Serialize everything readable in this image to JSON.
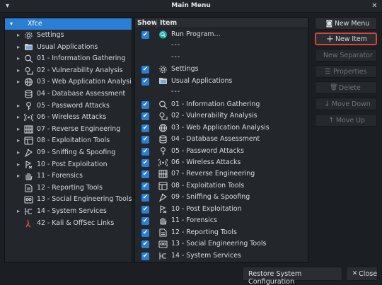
{
  "window": {
    "title": "Main Menu",
    "close_glyph": "✕",
    "menu_glyph": "▾"
  },
  "tree": {
    "root": {
      "label": "Xfce",
      "expander": "▾"
    },
    "items": [
      {
        "label": "Settings",
        "icon": "gear-icon",
        "expander": "▸"
      },
      {
        "label": "Usual Applications",
        "icon": "folder-icon",
        "expander": "▸"
      },
      {
        "label": "01 - Information Gathering",
        "icon": "magnifier-icon",
        "expander": "▸"
      },
      {
        "label": "02 - Vulnerability Analysis",
        "icon": "vulnerability-icon",
        "expander": "▸"
      },
      {
        "label": "03 - Web Application Analysis",
        "icon": "globe-icon",
        "expander": "▸"
      },
      {
        "label": "04 - Database Assessment",
        "icon": "database-icon",
        "expander": ""
      },
      {
        "label": "05 - Password Attacks",
        "icon": "key-icon",
        "expander": "▸"
      },
      {
        "label": "06 - Wireless Attacks",
        "icon": "wireless-icon",
        "expander": "▸"
      },
      {
        "label": "07 - Reverse Engineering",
        "icon": "chip-icon",
        "expander": "▸"
      },
      {
        "label": "08 - Exploitation Tools",
        "icon": "exploit-icon",
        "expander": "▸"
      },
      {
        "label": "09 - Sniffing & Spoofing",
        "icon": "sniff-icon",
        "expander": "▸"
      },
      {
        "label": "10 - Post Exploitation",
        "icon": "post-exploit-icon",
        "expander": "▸"
      },
      {
        "label": "11 - Forensics",
        "icon": "hand-icon",
        "expander": "▸"
      },
      {
        "label": "12 - Reporting Tools",
        "icon": "report-icon",
        "expander": ""
      },
      {
        "label": "13 - Social Engineering Tools",
        "icon": "social-icon",
        "expander": ""
      },
      {
        "label": "14 - System Services",
        "icon": "services-icon",
        "expander": "▸"
      },
      {
        "label": "42 - Kali & OffSec Links",
        "icon": "kali-dragon-icon",
        "expander": ""
      }
    ]
  },
  "list": {
    "headers": {
      "show": "Show",
      "item": "Item"
    },
    "check_glyph": "✔",
    "rows": [
      {
        "type": "item",
        "label": "Run Program...",
        "icon": "run-program-icon",
        "checked": true
      },
      {
        "type": "separator",
        "label": "---"
      },
      {
        "type": "separator",
        "label": "---"
      },
      {
        "type": "item",
        "label": "Settings",
        "icon": "gear-icon",
        "checked": true
      },
      {
        "type": "item",
        "label": "Usual Applications",
        "icon": "folder-icon",
        "checked": true
      },
      {
        "type": "separator",
        "label": "---"
      },
      {
        "type": "item",
        "label": "01 - Information Gathering",
        "icon": "magnifier-icon",
        "checked": true
      },
      {
        "type": "item",
        "label": "02 - Vulnerability Analysis",
        "icon": "vulnerability-icon",
        "checked": true
      },
      {
        "type": "item",
        "label": "03 - Web Application Analysis",
        "icon": "globe-icon",
        "checked": true
      },
      {
        "type": "item",
        "label": "04 - Database Assessment",
        "icon": "database-icon",
        "checked": true
      },
      {
        "type": "item",
        "label": "05 - Password Attacks",
        "icon": "key-icon",
        "checked": true
      },
      {
        "type": "item",
        "label": "06 - Wireless Attacks",
        "icon": "wireless-icon",
        "checked": true
      },
      {
        "type": "item",
        "label": "07 - Reverse Engineering",
        "icon": "chip-icon",
        "checked": true
      },
      {
        "type": "item",
        "label": "08 - Exploitation Tools",
        "icon": "exploit-icon",
        "checked": true
      },
      {
        "type": "item",
        "label": "09 - Sniffing & Spoofing",
        "icon": "sniff-icon",
        "checked": true
      },
      {
        "type": "item",
        "label": "10 - Post Exploitation",
        "icon": "post-exploit-icon",
        "checked": true
      },
      {
        "type": "item",
        "label": "11 - Forensics",
        "icon": "hand-icon",
        "checked": true
      },
      {
        "type": "item",
        "label": "12 - Reporting Tools",
        "icon": "report-icon",
        "checked": true
      },
      {
        "type": "item",
        "label": "13 - Social Engineering Tools",
        "icon": "social-icon",
        "checked": true
      },
      {
        "type": "item",
        "label": "14 - System Services",
        "icon": "services-icon",
        "checked": true
      }
    ]
  },
  "actions": {
    "new_menu": {
      "label": "New Menu",
      "icon": "new-menu-icon",
      "glyph": "◙"
    },
    "new_item": {
      "label": "New Item",
      "icon": "plus-icon",
      "glyph": "+"
    },
    "new_separator": {
      "label": "New Separator"
    },
    "properties": {
      "label": "Properties",
      "icon": "properties-icon",
      "glyph": "☰"
    },
    "delete": {
      "label": "Delete",
      "icon": "trash-icon",
      "glyph": "🗑"
    },
    "move_down": {
      "label": "Move Down",
      "icon": "arrow-down-icon",
      "glyph": "↓"
    },
    "move_up": {
      "label": "Move Up",
      "icon": "arrow-up-icon",
      "glyph": "↑"
    }
  },
  "footer": {
    "restore": {
      "label": "Restore System Configuration"
    },
    "close": {
      "label": "Close",
      "icon": "close-icon",
      "glyph": "✕"
    }
  },
  "colors": {
    "selection": "#2a7fd4",
    "focus_outline": "#d9443a",
    "background": "#1b1e22",
    "panel": "#23272c"
  }
}
